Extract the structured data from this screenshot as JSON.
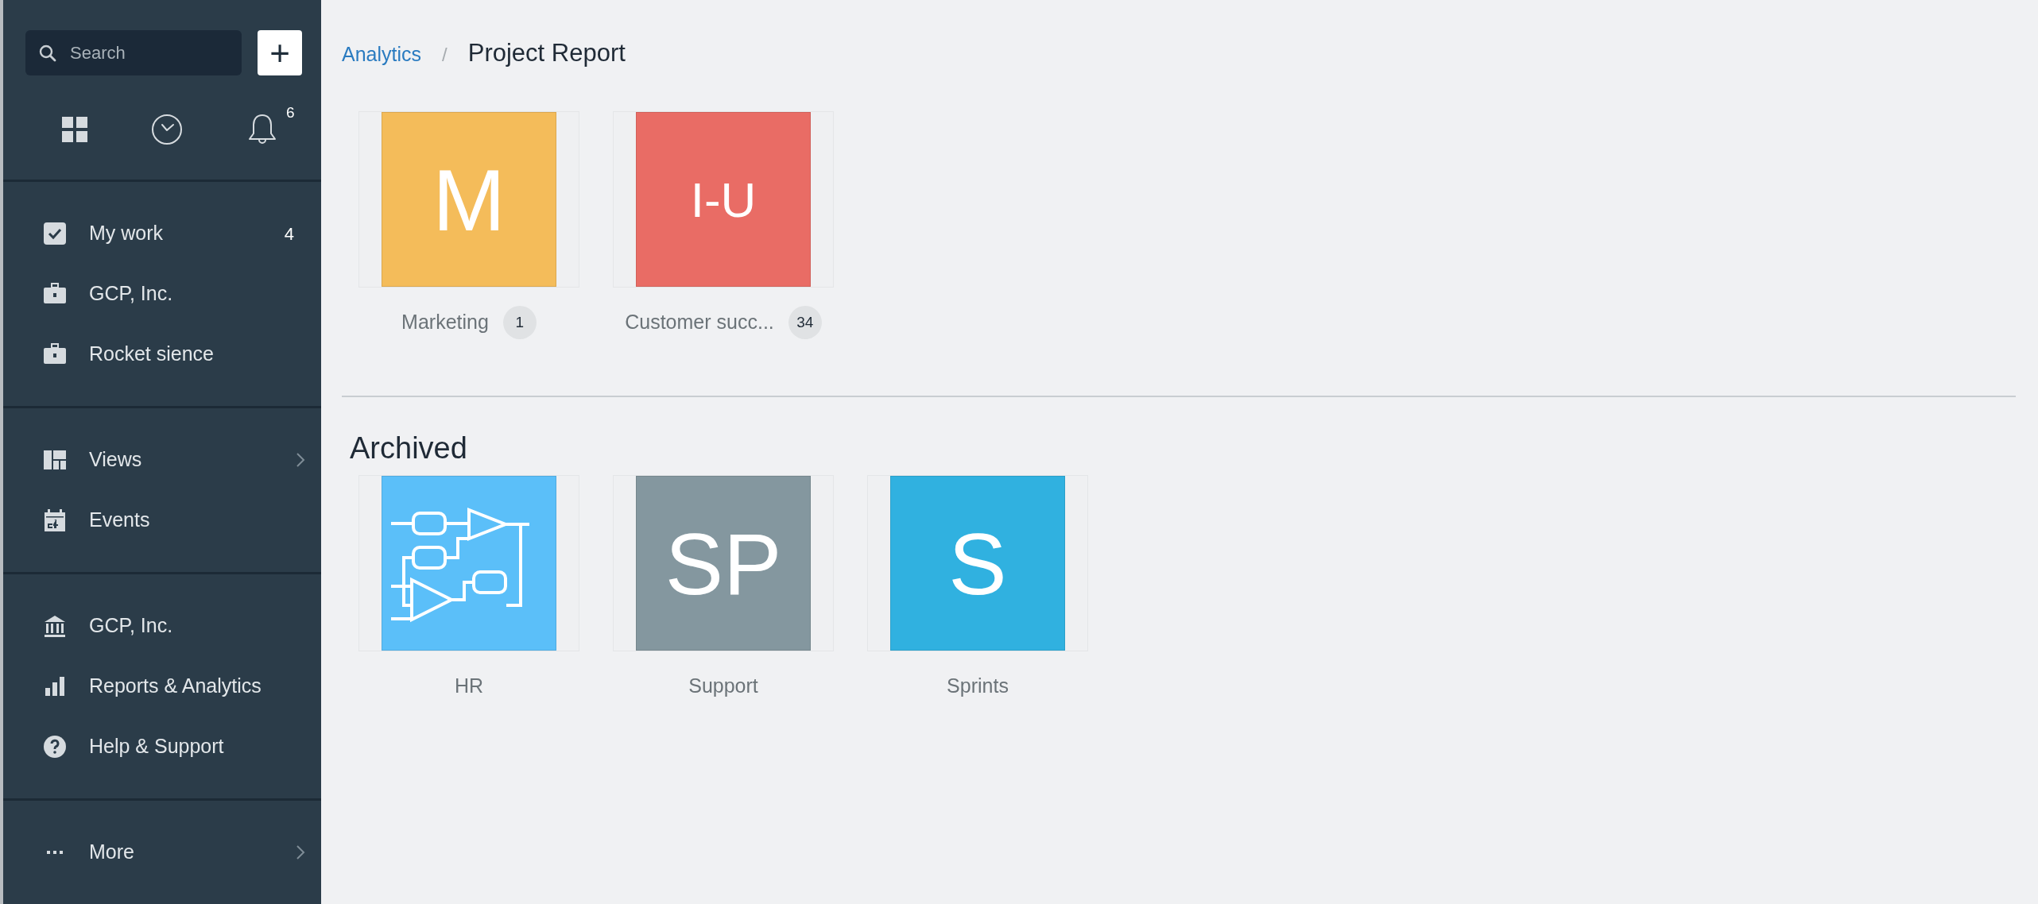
{
  "sidebar": {
    "search": {
      "placeholder": "Search"
    },
    "add_button": "+",
    "notification_count": "6",
    "groups": [
      [
        {
          "label": "My work",
          "count": "4",
          "submenu": false
        },
        {
          "label": "GCP, Inc.",
          "submenu": false
        },
        {
          "label": "Rocket sience",
          "submenu": false
        }
      ],
      [
        {
          "label": "Views",
          "submenu": true
        },
        {
          "label": "Events",
          "submenu": false
        }
      ],
      [
        {
          "label": "GCP, Inc.",
          "submenu": false
        },
        {
          "label": "Reports & Analytics",
          "submenu": false
        },
        {
          "label": "Help & Support",
          "submenu": false
        }
      ],
      [
        {
          "label": "More",
          "submenu": true
        }
      ]
    ]
  },
  "breadcrumb": {
    "parent": "Analytics",
    "separator": "/",
    "current": "Project Report"
  },
  "projects": [
    {
      "kind": "letters",
      "initials": "M",
      "color": "#f4bc5a",
      "name": "Marketing",
      "count": "1"
    },
    {
      "kind": "letters",
      "initials": "I-U",
      "color": "#e96c65",
      "name": "Customer succ...",
      "count": "34"
    }
  ],
  "archived": {
    "heading": "Archived",
    "projects": [
      {
        "kind": "circuit",
        "color": "#5bbff9",
        "name": "HR"
      },
      {
        "kind": "letters",
        "initials": "SP",
        "color": "#84979f",
        "name": "Support"
      },
      {
        "kind": "letters",
        "initials": "S",
        "color": "#30b1e0",
        "name": "Sprints"
      }
    ]
  }
}
